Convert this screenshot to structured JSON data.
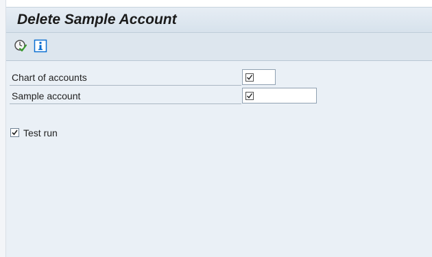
{
  "window": {
    "title": "Delete Sample Account"
  },
  "toolbar": {
    "buttons": [
      {
        "icon": "execute-clock-icon"
      },
      {
        "icon": "info-icon"
      }
    ]
  },
  "form": {
    "fields": [
      {
        "label": "Chart of accounts",
        "value": "",
        "required": true
      },
      {
        "label": "Sample account",
        "value": "",
        "required": true
      }
    ],
    "checkbox": {
      "label": "Test run",
      "checked": true
    }
  },
  "colors": {
    "accent": "#0a6ed1",
    "title_bar": "#dde6ee",
    "content_bg": "#eaf0f6"
  }
}
